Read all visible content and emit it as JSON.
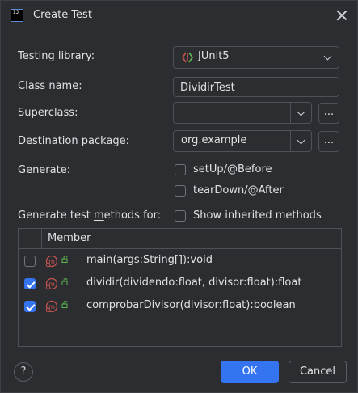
{
  "window": {
    "title": "Create Test",
    "logo_text": "IJ"
  },
  "form": {
    "testing_library": {
      "label_pre": "Testing ",
      "label_mnemonic": "l",
      "label_post": "ibrary:",
      "value": "JUnit5"
    },
    "class_name": {
      "label": "Class name:",
      "value": "DividirTest"
    },
    "superclass": {
      "label": "Superclass:",
      "value": "",
      "browse_label": "..."
    },
    "destination_package": {
      "label": "Destination package:",
      "value": "org.example",
      "browse_label": "..."
    },
    "generate": {
      "label": "Generate:",
      "options": [
        {
          "label": "setUp/@Before",
          "checked": false
        },
        {
          "label": "tearDown/@After",
          "checked": false
        }
      ]
    },
    "test_methods": {
      "label_pre": "Generate test ",
      "label_mnemonic": "m",
      "label_post": "ethods for:",
      "show_inherited_label": "Show inherited methods",
      "show_inherited_checked": false
    }
  },
  "table": {
    "header": "Member",
    "rows": [
      {
        "signature": "main(args:String[]):void",
        "checked": false
      },
      {
        "signature": "dividir(dividendo:float, divisor:float):float",
        "checked": true
      },
      {
        "signature": "comprobarDivisor(divisor:float):boolean",
        "checked": true
      }
    ]
  },
  "footer": {
    "help_label": "?",
    "ok_label": "OK",
    "cancel_label": "Cancel"
  },
  "colors": {
    "accent": "#3574f0",
    "background": "#2b2d30",
    "method_icon": "#c75450",
    "access_icon": "#5fb84f"
  }
}
